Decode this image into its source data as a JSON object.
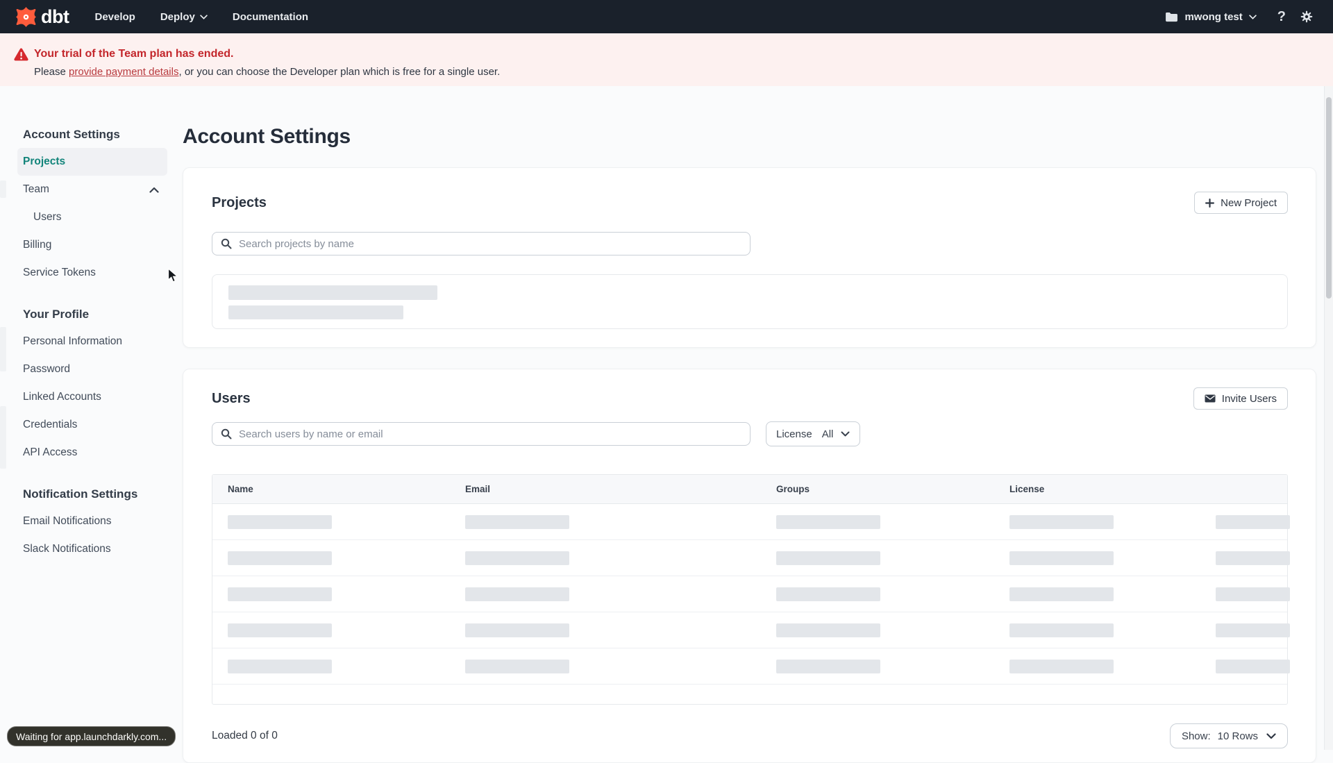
{
  "nav": {
    "logo_text": "dbt",
    "items": [
      "Develop",
      "Deploy",
      "Documentation"
    ],
    "account_label": "mwong test"
  },
  "banner": {
    "title": "Your trial of the Team plan has ended.",
    "message_prefix": "Please ",
    "link_text": "provide payment details",
    "message_suffix": ", or you can choose the Developer plan which is free for a single user."
  },
  "sidebar": {
    "sections": [
      {
        "heading": "Account Settings",
        "items": [
          "Projects",
          "Team",
          "Users",
          "Billing",
          "Service Tokens"
        ]
      },
      {
        "heading": "Your Profile",
        "items": [
          "Personal Information",
          "Password",
          "Linked Accounts",
          "Credentials",
          "API Access"
        ]
      },
      {
        "heading": "Notification Settings",
        "items": [
          "Email Notifications",
          "Slack Notifications"
        ]
      }
    ]
  },
  "main": {
    "page_title": "Account Settings",
    "projects_card": {
      "title": "Projects",
      "new_project_label": "New Project",
      "search_placeholder": "Search projects by name"
    },
    "users_card": {
      "title": "Users",
      "invite_label": "Invite Users",
      "search_placeholder": "Search users by name or email",
      "license_filter": {
        "label": "License",
        "value": "All"
      },
      "table": {
        "columns": [
          "Name",
          "Email",
          "Groups",
          "License"
        ]
      },
      "footer": {
        "loaded_text": "Loaded 0 of 0",
        "show_label": "Show:",
        "show_value": "10 Rows"
      }
    }
  },
  "status_bar": {
    "text": "Waiting for app.launchdarkly.com..."
  },
  "colors": {
    "brand_orange": "#ff5c3c",
    "accent_teal": "#12847a",
    "warning_red": "#c3262b",
    "nav_bg": "#1a212b"
  }
}
